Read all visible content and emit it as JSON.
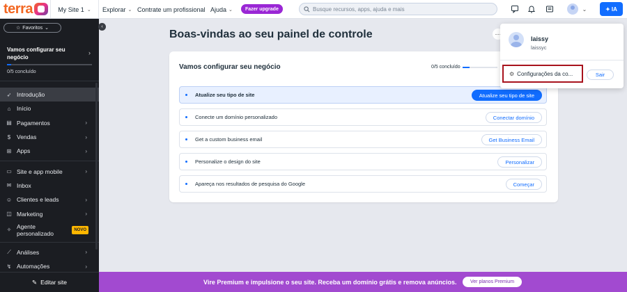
{
  "topbar": {
    "logo_text": "terra",
    "site_name": "My Site 1",
    "nav": {
      "explore": "Explorar",
      "hire": "Contrate um profissional",
      "help": "Ajuda"
    },
    "upgrade_label": "Fazer upgrade",
    "search_placeholder": "Busque recursos, apps, ajuda e mais",
    "icons": [
      "chat-icon",
      "bell-icon",
      "news-icon",
      "avatar",
      "chevron-down-icon"
    ],
    "ai_label": "IA"
  },
  "sidebar": {
    "favorites_label": "Favoritos",
    "setup": {
      "title": "Vamos configurar seu negócio",
      "progress_text": "0/5 concluído",
      "progress": 0.05
    },
    "items": [
      {
        "label": "Introdução",
        "icon": "rocket-icon",
        "active": true,
        "arrow": false
      },
      {
        "label": "Início",
        "icon": "home-icon",
        "active": false,
        "arrow": false
      },
      {
        "label": "Pagamentos",
        "icon": "payments-icon",
        "active": false,
        "arrow": true
      },
      {
        "label": "Vendas",
        "icon": "sales-icon",
        "active": false,
        "arrow": true
      },
      {
        "label": "Apps",
        "icon": "apps-icon",
        "active": false,
        "arrow": true
      },
      {
        "label": "Site e app mobile",
        "icon": "site-icon",
        "active": false,
        "arrow": true
      },
      {
        "label": "Inbox",
        "icon": "inbox-icon",
        "active": false,
        "arrow": false
      },
      {
        "label": "Clientes e leads",
        "icon": "clients-icon",
        "active": false,
        "arrow": true
      },
      {
        "label": "Marketing",
        "icon": "marketing-icon",
        "active": false,
        "arrow": true
      },
      {
        "label": "Agente personalizado",
        "icon": "agent-icon",
        "active": false,
        "arrow": false,
        "badge": "NOVO"
      },
      {
        "label": "Análises",
        "icon": "analytics-icon",
        "active": false,
        "arrow": true
      },
      {
        "label": "Automações",
        "icon": "automation-icon",
        "active": false,
        "arrow": true
      }
    ],
    "edit_site_label": "Editar site"
  },
  "main": {
    "title": "Boas-vindas ao seu painel de controle",
    "card": {
      "title": "Vamos configurar seu negócio",
      "progress_text": "0/5 concluído",
      "progress": 0.2,
      "tasks": [
        {
          "label": "Atualize seu tipo de site",
          "button": "Atualize seu tipo de site",
          "highlight": true
        },
        {
          "label": "Conecte um domínio personalizado",
          "button": "Conectar domínio",
          "highlight": false
        },
        {
          "label": "Get a custom business email",
          "button": "Get Business Email",
          "highlight": false
        },
        {
          "label": "Personalize o design do site",
          "button": "Personalizar",
          "highlight": false
        },
        {
          "label": "Apareça nos resultados de pesquisa do Google",
          "button": "Começar",
          "highlight": false
        }
      ]
    }
  },
  "account_menu": {
    "name": "laissy",
    "username": "laissyc",
    "settings_label": "Configurações da co...",
    "logout_label": "Sair"
  },
  "banner": {
    "text": "Vire Premium e impulsione o seu site. Receba um domínio grátis e remova anúncios.",
    "button": "Ver planos Premium"
  },
  "colors": {
    "accent": "#116dff",
    "upgrade": "#9a27d5",
    "banner": "#a24ad0",
    "sidebar_bg": "#1b1d22",
    "highlight_border": "#a8121c"
  }
}
